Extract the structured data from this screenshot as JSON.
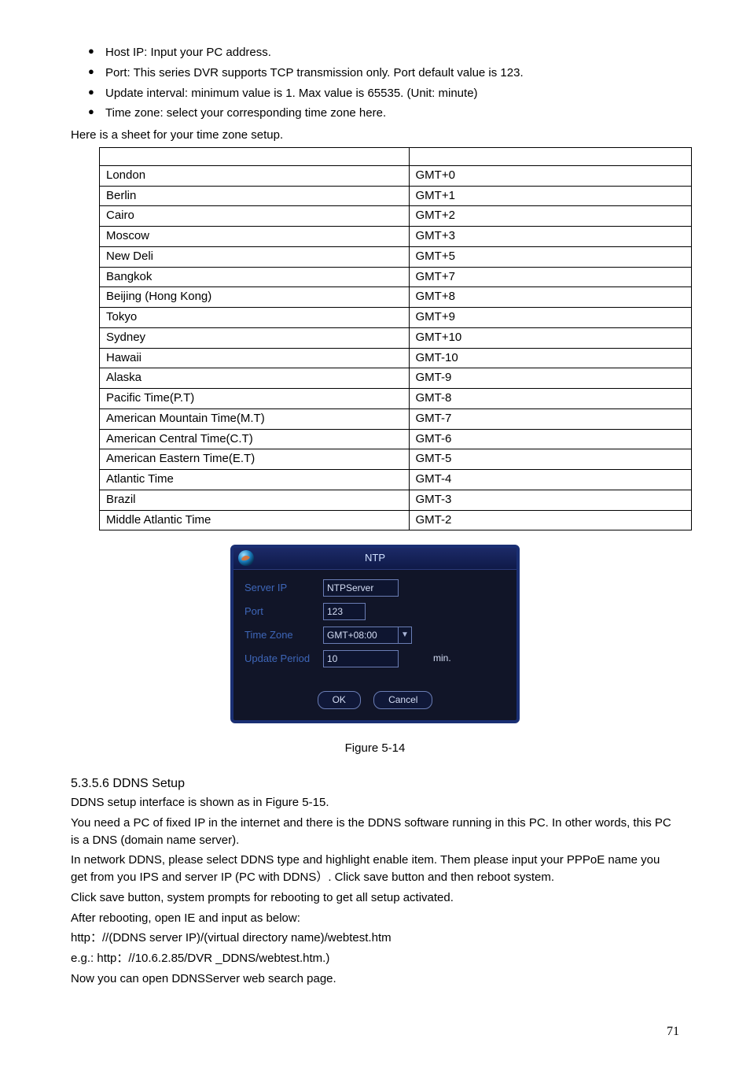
{
  "bullets": [
    "Host IP: Input your PC address.",
    "Port:  This series DVR supports TCP transmission only. Port default value is 123.",
    "Update interval: minimum value is 1. Max value is 65535. (Unit: minute)",
    "Time zone: select your corresponding time zone here."
  ],
  "sheet_intro": "Here is a sheet for your time zone setup.",
  "table": [
    [
      "",
      ""
    ],
    [
      "London",
      "GMT+0"
    ],
    [
      "Berlin",
      "GMT+1"
    ],
    [
      "Cairo",
      "GMT+2"
    ],
    [
      "Moscow",
      "GMT+3"
    ],
    [
      "New Deli",
      "GMT+5"
    ],
    [
      "Bangkok",
      "GMT+7"
    ],
    [
      "Beijing (Hong Kong)",
      "GMT+8"
    ],
    [
      "Tokyo",
      "GMT+9"
    ],
    [
      "Sydney",
      "GMT+10"
    ],
    [
      "Hawaii",
      "GMT-10"
    ],
    [
      "Alaska",
      "GMT-9"
    ],
    [
      "Pacific Time(P.T)",
      "GMT-8"
    ],
    [
      "American  Mountain Time(M.T)",
      "GMT-7"
    ],
    [
      "American Central Time(C.T)",
      "GMT-6"
    ],
    [
      "American Eastern Time(E.T)",
      "GMT-5"
    ],
    [
      "Atlantic Time",
      "GMT-4"
    ],
    [
      "Brazil",
      "GMT-3"
    ],
    [
      "Middle Atlantic Time",
      "GMT-2"
    ]
  ],
  "dialog": {
    "title": "NTP",
    "server_ip_label": "Server IP",
    "server_ip_value": "NTPServer",
    "port_label": "Port",
    "port_value": "123",
    "timezone_label": "Time Zone",
    "timezone_value": "GMT+08:00",
    "update_label": "Update Period",
    "update_value": "10",
    "min_label": "min.",
    "ok": "OK",
    "cancel": "Cancel"
  },
  "figure_caption": "Figure 5-14",
  "section_heading": "5.3.5.6  DDNS Setup",
  "paragraphs": [
    "DDNS setup interface is shown as in Figure 5-15.",
    "You need a PC of fixed IP in the internet and there is the DDNS software running in this PC. In other words, this PC is a DNS (domain name server).",
    "In network DDNS, please select DDNS type and highlight enable item. Them please input your PPPoE name you get from you IPS and server IP (PC with DDNS）. Click save button and then reboot system.",
    "Click save button, system prompts for rebooting to get all setup activated.",
    "After rebooting, open IE and input as below:",
    "http：//(DDNS server IP)/(virtual directory name)/webtest.htm",
    "e.g.: http：//10.6.2.85/DVR _DDNS/webtest.htm.)",
    "Now you can open DDNSServer web search page."
  ],
  "page_number": "71"
}
